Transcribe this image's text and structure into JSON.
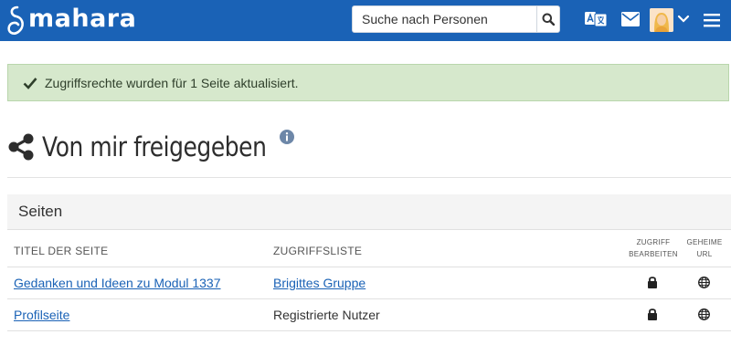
{
  "header": {
    "logo_text": "mahara",
    "search": {
      "placeholder": "Suche nach Personen"
    }
  },
  "alert": {
    "message": "Zugriffsrechte wurden für 1 Seite aktualisiert."
  },
  "page": {
    "title": "Von mir freigegeben"
  },
  "panel": {
    "heading": "Seiten",
    "columns": {
      "title": "TITEL DER SEITE",
      "access_list": "ZUGRIFFSLISTE",
      "edit_access_line1": "ZUGRIFF",
      "edit_access_line2": "BEARBEITEN",
      "secret_url_line1": "GEHEIME",
      "secret_url_line2": "URL"
    },
    "rows": [
      {
        "title": "Gedanken und Ideen zu Modul 1337",
        "access": "Brigittes Gruppe"
      },
      {
        "title": "Profilseite",
        "access": "Registrierte Nutzer"
      }
    ]
  },
  "colors": {
    "header_bg": "#1a62b6",
    "alert_bg": "#d6e8cc",
    "link": "#1a62b6"
  },
  "icons": [
    "search-icon",
    "language-icon",
    "mail-icon",
    "avatar",
    "chevron-down-icon",
    "menu-icon",
    "check-icon",
    "share-icon",
    "info-icon",
    "lock-icon",
    "globe-icon"
  ]
}
